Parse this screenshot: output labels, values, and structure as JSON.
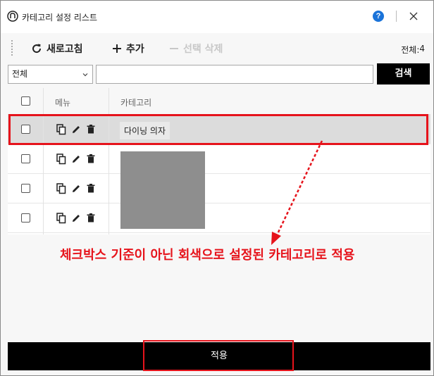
{
  "window": {
    "title": "카테고리 설정 리스트",
    "help_label": "?"
  },
  "toolbar": {
    "refresh_label": "새로고침",
    "add_label": "추가",
    "delete_label": "선택 삭제",
    "total_label": "전체:",
    "total_count": "4"
  },
  "search": {
    "select_value": "전체",
    "input_value": "",
    "input_placeholder": "",
    "button_label": "검색"
  },
  "grid": {
    "headers": [
      "메뉴",
      "카테고리"
    ],
    "rows": [
      {
        "category": "다이닝 의자",
        "selected": true
      },
      {
        "category": "",
        "selected": false
      },
      {
        "category": "",
        "selected": false
      },
      {
        "category": "",
        "selected": false
      }
    ]
  },
  "annotation": {
    "text": "체크박스 기준이 아닌 회색으로 설정된 카테고리로 적용",
    "color": "#e6131b"
  },
  "footer": {
    "apply_label": "적용"
  },
  "icons": [
    "app-icon",
    "help-icon",
    "close-icon",
    "refresh-icon",
    "plus-icon",
    "minus-icon",
    "chevron-down-icon",
    "copy-icon",
    "edit-icon",
    "trash-icon"
  ]
}
